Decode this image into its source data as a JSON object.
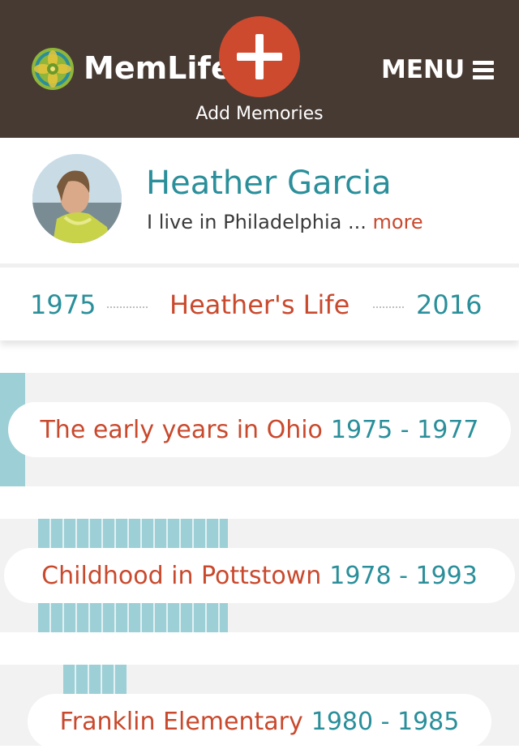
{
  "header": {
    "logo_text": "MemLife",
    "add_label": "Add Memories",
    "menu_label": "MENU"
  },
  "profile": {
    "name": "Heather Garcia",
    "bio": "I live in Philadelphia ...",
    "more_label": "more"
  },
  "lifebar": {
    "start_year": "1975",
    "title": "Heather's Life",
    "end_year": "2016"
  },
  "periods": [
    {
      "title": "The early years in Ohio",
      "range": "1975 - 1977"
    },
    {
      "title": "Childhood in Pottstown",
      "range": "1978 - 1993"
    },
    {
      "title": "Franklin Elementary",
      "range": "1980 - 1985"
    }
  ],
  "colors": {
    "header_bg": "#473a33",
    "accent_orange": "#cd4a2e",
    "accent_teal": "#2a8f9a",
    "bar_teal": "#9dcfd6"
  }
}
